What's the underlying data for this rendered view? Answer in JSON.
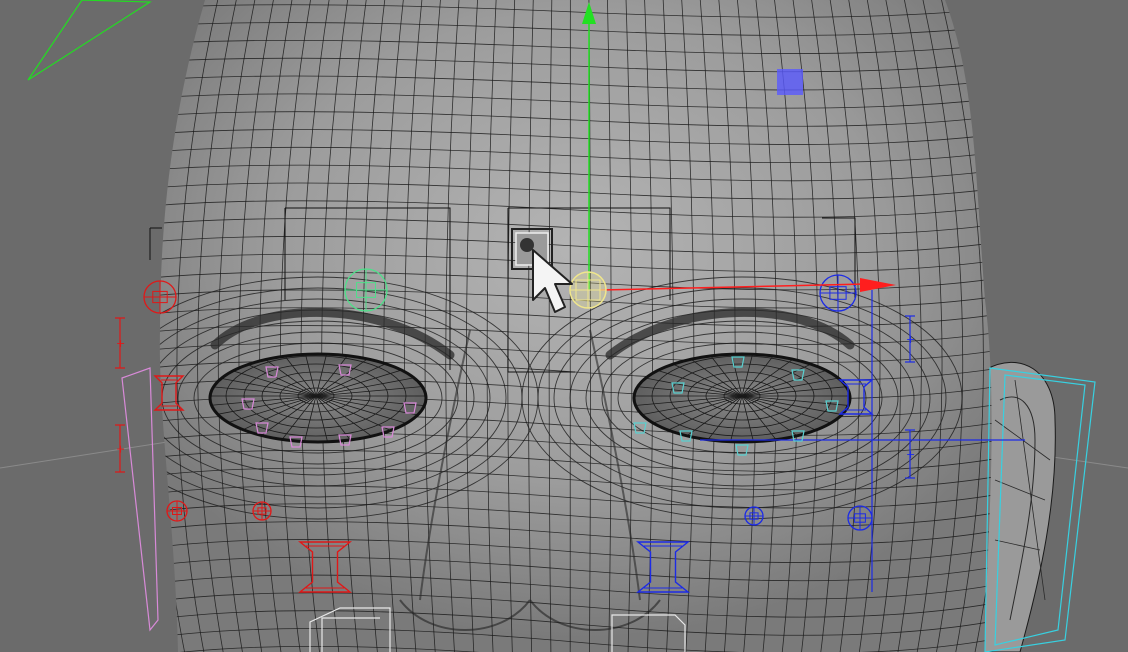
{
  "viewport": {
    "background_color": "#6b6b6b",
    "mesh_fill_color": "#a9a9a9",
    "wire_color": "#1a1a1a"
  },
  "gizmo": {
    "x_axis_color": "#ff1e1e",
    "y_axis_color": "#22e022",
    "plane_handle_color": "#5a5aff",
    "center_color": "#f0e68c"
  },
  "controls": {
    "left_side_color": "#e01818",
    "right_side_color": "#1c2be6",
    "center_color": "#4ee08a",
    "eyelid_left_color": "#d88ad8",
    "eyelid_right_color": "#5ad0d0",
    "ear_box_color": "#38d0e0",
    "camera_frustum_color": "#22dd22",
    "bounding_box_color": "#111111"
  },
  "cursor": {
    "icon": "arrow-pointer-icon"
  }
}
